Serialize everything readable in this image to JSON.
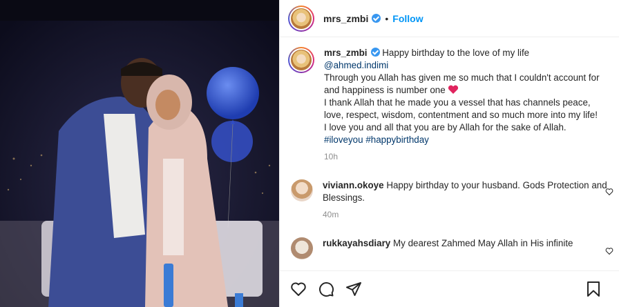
{
  "header": {
    "username": "mrs_zmbi",
    "dot": "•",
    "follow_label": "Follow"
  },
  "caption": {
    "username": "mrs_zmbi",
    "line1": "Happy birthday to the love of my life",
    "mention": "@ahmed.indimi",
    "line2": "Through you Allah has given me so much that I couldn't account for and happiness is number one",
    "line3": "I thank Allah that he made you a vessel that has channels peace, love, respect, wisdom, contentment and so much more into my life!",
    "line4": "I love you and all that you are by Allah for the sake of Allah.",
    "hashtag1": "#iloveyou",
    "hashtag2": "#happybirthday",
    "time": "10h"
  },
  "comments": [
    {
      "username": "viviann.okoye",
      "text": "Happy birthday to your husband. Gods Protection and Blessings.",
      "time": "40m"
    },
    {
      "username": "rukkayahsdiary",
      "text": "My dearest Zahmed May Allah in His infinite"
    }
  ],
  "icons": [
    "heart-icon",
    "comment-icon",
    "share-icon",
    "bookmark-icon",
    "verified-badge-icon",
    "red-heart-emoji"
  ],
  "colors": {
    "follow": "#0095f6",
    "verified": "#3897f0",
    "link": "#00376b",
    "muted": "#8e8e8e"
  }
}
